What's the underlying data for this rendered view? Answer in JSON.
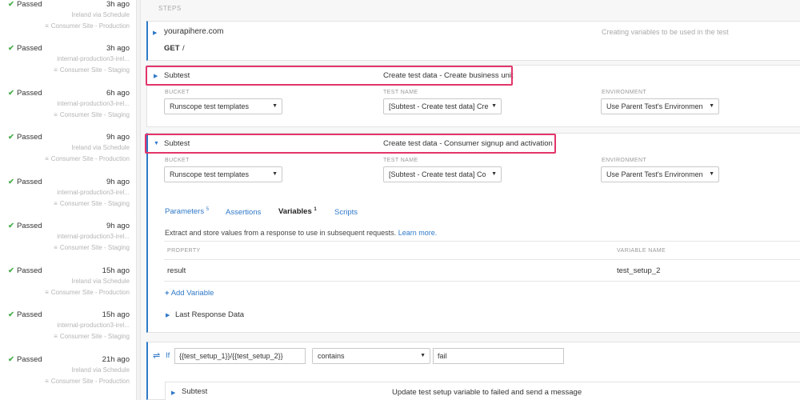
{
  "sidebar": {
    "runs": [
      {
        "status": "Passed",
        "ago": "3h ago",
        "location": "Ireland via Schedule",
        "env": "Consumer Site - Production"
      },
      {
        "status": "Passed",
        "ago": "3h ago",
        "location": "internal-production3-irel...",
        "env": "Consumer Site - Staging"
      },
      {
        "status": "Passed",
        "ago": "6h ago",
        "location": "internal-production3-irel...",
        "env": "Consumer Site - Staging"
      },
      {
        "status": "Passed",
        "ago": "9h ago",
        "location": "Ireland via Schedule",
        "env": "Consumer Site - Production"
      },
      {
        "status": "Passed",
        "ago": "9h ago",
        "location": "internal-production3-irel...",
        "env": "Consumer Site - Staging"
      },
      {
        "status": "Passed",
        "ago": "9h ago",
        "location": "internal-production3-irel...",
        "env": "Consumer Site - Staging"
      },
      {
        "status": "Passed",
        "ago": "15h ago",
        "location": "Ireland via Schedule",
        "env": "Consumer Site - Production"
      },
      {
        "status": "Passed",
        "ago": "15h ago",
        "location": "internal-production3-irel...",
        "env": "Consumer Site - Staging"
      },
      {
        "status": "Passed",
        "ago": "21h ago",
        "location": "Ireland via Schedule",
        "env": "Consumer Site - Production"
      }
    ]
  },
  "steps_label": "STEPS",
  "step1": {
    "host": "yourapihere.com",
    "method": "GET",
    "path": "/",
    "description": "Creating variables to be used in the test"
  },
  "step2": {
    "type": "Subtest",
    "title": "Create test data - Create business unit",
    "bucket_label": "BUCKET",
    "bucket": "Runscope test templates",
    "test_label": "TEST NAME",
    "test": "[Subtest - Create test data] Cre",
    "env_label": "ENVIRONMENT",
    "env": "Use Parent Test's Environmen"
  },
  "step3": {
    "type": "Subtest",
    "title": "Create test data - Consumer signup and activation",
    "bucket_label": "BUCKET",
    "bucket": "Runscope test templates",
    "test_label": "TEST NAME",
    "test": "[Subtest - Create test data] Co",
    "env_label": "ENVIRONMENT",
    "env": "Use Parent Test's Environmen",
    "tabs": {
      "parameters": "Parameters",
      "parameters_count": "5",
      "assertions": "Assertions",
      "variables": "Variables",
      "variables_count": "1",
      "scripts": "Scripts"
    },
    "help_text": "Extract and store values from a response to use in subsequent requests.",
    "learn_more": "Learn more.",
    "col_property": "PROPERTY",
    "col_variable": "VARIABLE NAME",
    "row_property": "result",
    "row_variable": "test_setup_2",
    "add_variable": "Add Variable",
    "last_response": "Last Response Data"
  },
  "condition": {
    "if_label": "If",
    "left": "{{test_setup_1}}/{{test_setup_2}}",
    "operator": "contains",
    "right": "fail"
  },
  "step4": {
    "type": "Subtest",
    "title": "Update test setup variable to failed and send a message"
  },
  "colors": {
    "accent": "#2e78c8",
    "highlight": "#e2356a",
    "passed": "#4caf50"
  }
}
